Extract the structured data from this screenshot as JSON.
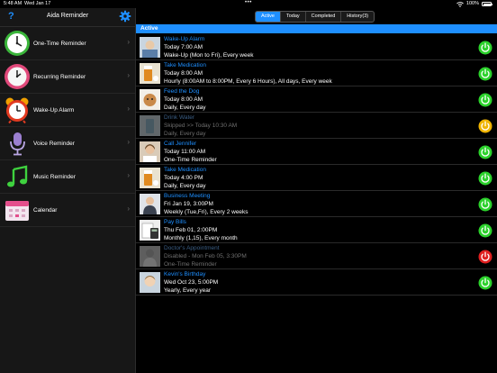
{
  "status_bar": {
    "time": "5:48 AM",
    "date": "Wed Jan 17",
    "multitask": "•••",
    "battery": "100%"
  },
  "sidebar": {
    "title": "Aida Reminder",
    "help_label": "?",
    "items": [
      {
        "label": "One-Time Reminder",
        "icon": "clock-icon"
      },
      {
        "label": "Recurring Reminder",
        "icon": "recurring-clock-icon"
      },
      {
        "label": "Wake-Up Alarm",
        "icon": "alarm-clock-icon"
      },
      {
        "label": "Voice Reminder",
        "icon": "microphone-icon"
      },
      {
        "label": "Music Reminder",
        "icon": "music-note-icon"
      },
      {
        "label": "Calendar",
        "icon": "calendar-icon"
      }
    ]
  },
  "tabs": {
    "active": "Active",
    "today": "Today",
    "completed": "Completed",
    "history": "History(3)"
  },
  "section_label": "Active",
  "colors": {
    "accent": "#1e8fff",
    "on": "#2bd12b",
    "snoozed": "#f0b400",
    "disabled": "#e02020"
  },
  "reminders": [
    {
      "title": "Wake-Up Alarm",
      "line1": "Today 7:00 AM",
      "line2": "Wake-Up (Mon to Fri), Every week",
      "status": "on",
      "thumb": "photo-icon"
    },
    {
      "title": "Take Medication",
      "line1": "Today 8:00 AM",
      "line2": "Hourly (8:00AM to 8:00PM, Every 6 Hours), All days, Every week",
      "status": "on",
      "thumb": "medication-icon"
    },
    {
      "title": "Feed the Dog",
      "line1": "Today 8:00 AM",
      "line2": "Daily, Every day",
      "status": "on",
      "thumb": "dog-icon"
    },
    {
      "title": "Drink Water",
      "line1": "Skipped >> Today 10:30 AM",
      "line2": "Daily, Every day",
      "status": "skipped",
      "thumb": "water-icon"
    },
    {
      "title": "Call Jennifer",
      "line1": "Today 11:00 AM",
      "line2": "One-Time Reminder",
      "status": "on",
      "thumb": "person-icon"
    },
    {
      "title": "Take Medication",
      "line1": "Today 4:00 PM",
      "line2": "Daily, Every day",
      "status": "on",
      "thumb": "medication-icon"
    },
    {
      "title": "Business Meeting",
      "line1": "Fri Jan 19, 3:00PM",
      "line2": "Weekly (Tue,Fri), Every 2 weeks",
      "status": "on",
      "thumb": "meeting-icon"
    },
    {
      "title": "Pay Bills",
      "line1": "Thu Feb 01, 2:00PM",
      "line2": "Monthly (1,15), Every month",
      "status": "on",
      "thumb": "bills-icon"
    },
    {
      "title": "Doctor's Appointment",
      "line1": "Disabled - Mon Feb 05, 3:30PM",
      "line2": "One-Time Reminder",
      "status": "off",
      "thumb": "doctor-icon"
    },
    {
      "title": "Kevin's Birthday",
      "line1": "Wed Oct 23, 5:00PM",
      "line2": "Yearly, Every year",
      "status": "on",
      "thumb": "person-icon"
    }
  ]
}
